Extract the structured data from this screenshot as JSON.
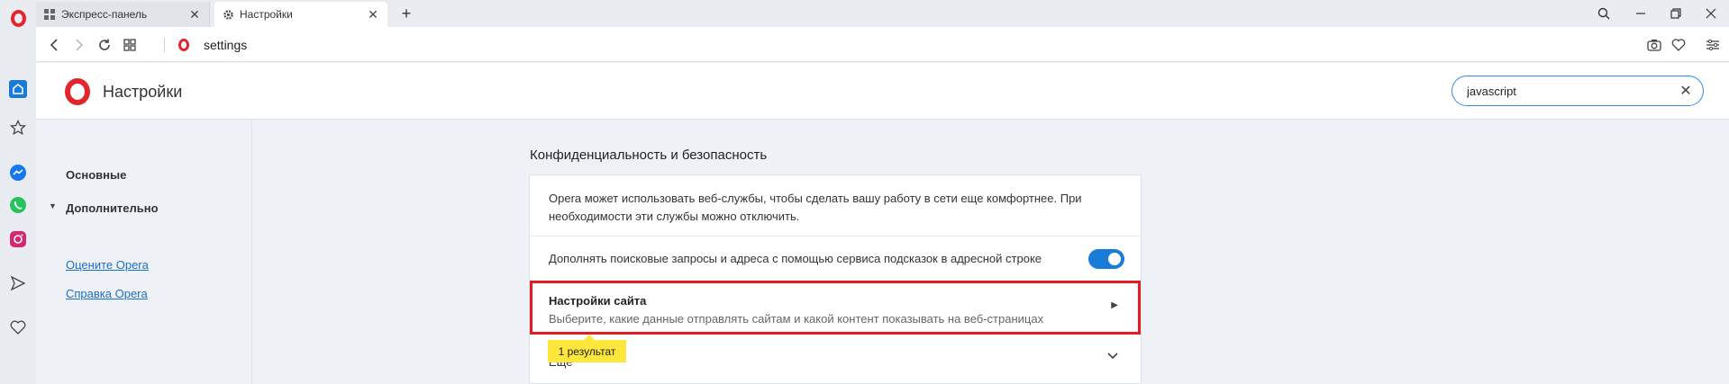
{
  "tabs": [
    {
      "label": "Экспресс-панель",
      "icon": "grid-icon"
    },
    {
      "label": "Настройки",
      "icon": "gear-icon"
    }
  ],
  "address_bar": {
    "url": "settings"
  },
  "header": {
    "title": "Настройки",
    "search_value": "javascript"
  },
  "settings_nav": {
    "basic": "Основные",
    "advanced": "Дополнительно",
    "rate_link": "Оцените Opera",
    "help_link": "Справка Opera"
  },
  "section": {
    "title": "Конфиденциальность и безопасность",
    "description": "Opera может использовать веб-службы, чтобы сделать вашу работу в сети еще комфортнее. При необходимости эти службы можно отключить.",
    "suggest_label": "Дополнять поисковые запросы и адреса с помощью сервиса подсказок в адресной строке",
    "suggest_enabled": true,
    "site_settings_title": "Настройки сайта",
    "site_settings_sub": "Выберите, какие данные отправлять сайтам и какой контент показывать на веб-страницах",
    "more_label": "Еще"
  },
  "search_result_badge": "1 результат",
  "colors": {
    "accent": "#1a7bd8",
    "brand": "#e3262d",
    "highlight": "#fde73d",
    "outline": "#e41b23"
  }
}
